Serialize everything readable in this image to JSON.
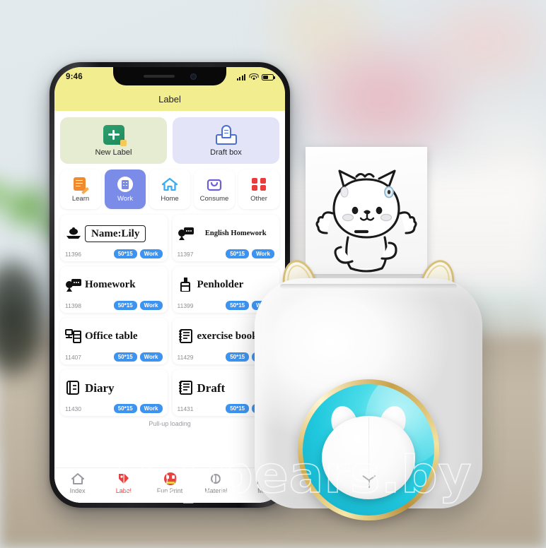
{
  "background": {
    "scene_description": "blurred desk scene with plant, pink bokeh and wood table",
    "watermark": "topbears.by"
  },
  "phone": {
    "status_bar": {
      "time": "9:46",
      "icons": [
        "signal-icon",
        "wifi-icon",
        "battery-icon"
      ]
    },
    "header": {
      "title": "Label"
    },
    "quick_actions": [
      {
        "label": "New Label",
        "icon": "new-label-icon",
        "accent": "#e6ecd2"
      },
      {
        "label": "Draft box",
        "icon": "draft-box-icon",
        "accent": "#e4e4f9"
      }
    ],
    "categories": [
      {
        "label": "Learn",
        "icon": "learn-icon",
        "active": false
      },
      {
        "label": "Work",
        "icon": "work-icon",
        "active": true
      },
      {
        "label": "Home",
        "icon": "home-icon",
        "active": false
      },
      {
        "label": "Consume",
        "icon": "consume-icon",
        "active": false
      },
      {
        "label": "Other",
        "icon": "other-icon",
        "active": false
      }
    ],
    "templates": [
      {
        "title": "Name:Lily",
        "id": "11396",
        "size_badge": "50*15",
        "category_badge": "Work",
        "icon": "boat-icon"
      },
      {
        "title": "English Homework",
        "id": "11397",
        "size_badge": "50*15",
        "category_badge": "Work",
        "icon": "speech-bubble-icon"
      },
      {
        "title": "Homework",
        "id": "11398",
        "size_badge": "50*15",
        "category_badge": "Work",
        "icon": "speech-bubble-icon"
      },
      {
        "title": "Penholder",
        "id": "11399",
        "size_badge": "50*15",
        "category_badge": "Work",
        "icon": "penholder-icon"
      },
      {
        "title": "Office table",
        "id": "11407",
        "size_badge": "50*15",
        "category_badge": "Work",
        "icon": "desk-icon"
      },
      {
        "title": "exercise book",
        "id": "11429",
        "size_badge": "50*15",
        "category_badge": "Work",
        "icon": "notebook-icon"
      },
      {
        "title": "Diary",
        "id": "11430",
        "size_badge": "50*15",
        "category_badge": "Work",
        "icon": "diary-icon"
      },
      {
        "title": "Draft",
        "id": "11431",
        "size_badge": "50*15",
        "category_badge": "Work",
        "icon": "notebook-icon"
      }
    ],
    "loading_text": "Pull-up loading",
    "tabs": [
      {
        "label": "Index",
        "icon": "home-outline-icon",
        "active": false
      },
      {
        "label": "Label",
        "icon": "tag-icon",
        "active": true
      },
      {
        "label": "Fun Print",
        "icon": "fun-print-icon",
        "active": false
      },
      {
        "label": "Material",
        "icon": "material-icon",
        "active": false
      },
      {
        "label": "Me",
        "icon": "person-icon",
        "active": false
      }
    ]
  },
  "printer": {
    "device_name": "cat-ear mini label printer",
    "colors": {
      "body": "#ffffff",
      "ring": "#caa54c",
      "led": "#2bcde0"
    },
    "printed_sticker": "line-art cat drawing"
  }
}
